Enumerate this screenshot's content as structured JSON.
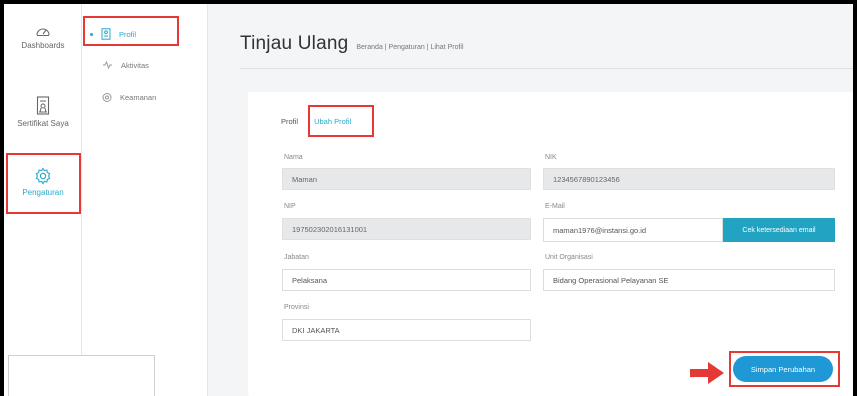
{
  "rail": {
    "items": [
      {
        "label": "Dashboards",
        "icon": "gauge-icon"
      },
      {
        "label": "Sertifikat Saya",
        "icon": "certificate-icon"
      },
      {
        "label": "Pengaturan",
        "icon": "gear-icon"
      }
    ]
  },
  "submenu": {
    "items": [
      {
        "label": "Profil",
        "icon": "profile-card-icon"
      },
      {
        "label": "Aktivitas",
        "icon": "activity-icon"
      },
      {
        "label": "Keamanan",
        "icon": "shield-icon"
      }
    ]
  },
  "header": {
    "title": "Tinjau Ulang",
    "breadcrumb": "Beranda | Pengaturan | Lihat Profil"
  },
  "tabs": [
    {
      "label": "Profil"
    },
    {
      "label": "Ubah Profil"
    }
  ],
  "form": {
    "nama_label": "Nama",
    "nama_value": "Maman",
    "nik_label": "NIK",
    "nik_value": "1234567890123456",
    "nip_label": "NIP",
    "nip_value": "197502302016131001",
    "email_label": "E-Mail",
    "email_value": "maman1976@instansi.go.id",
    "check_email_label": "Cek ketersediaan email",
    "jabatan_label": "Jabatan",
    "jabatan_value": "Pelaksana",
    "unit_label": "Unit Organisasi",
    "unit_value": "Bidang Operasional Pelayanan SE",
    "provinsi_label": "Provinsi",
    "provinsi_value": "DKI JAKARTA",
    "save_label": "Simpan Perubahan"
  },
  "colors": {
    "accent": "#2aa9c9",
    "highlight": "#e53935",
    "save_button": "#1f98d6"
  }
}
